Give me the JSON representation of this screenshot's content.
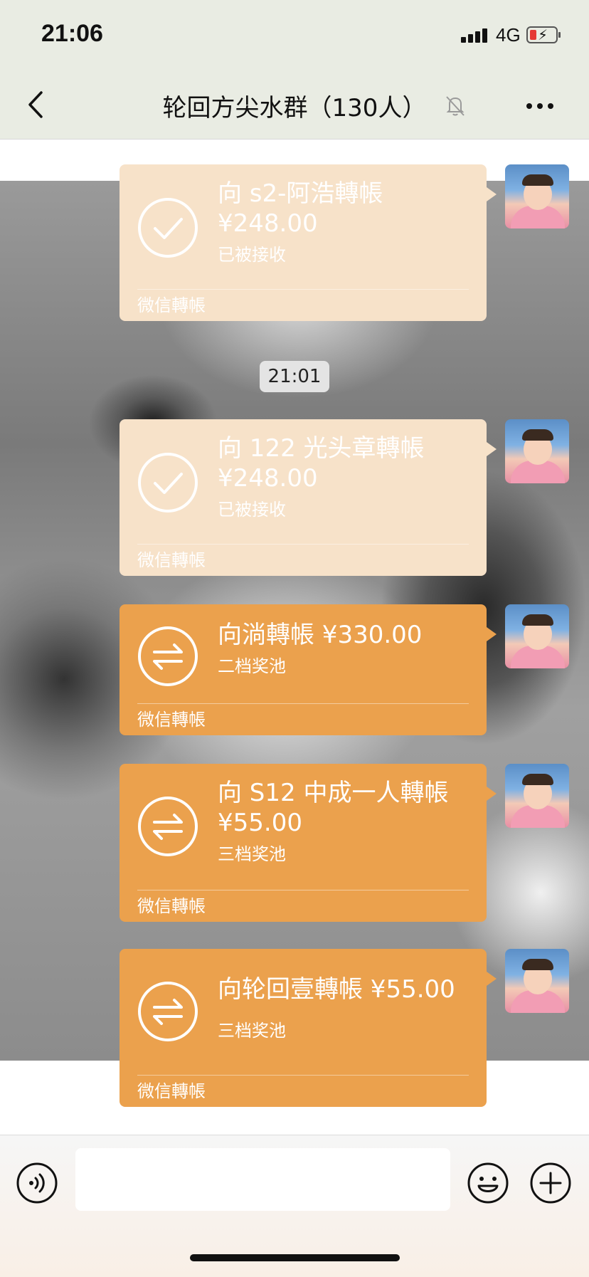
{
  "status_bar": {
    "time": "21:06",
    "network": "4G"
  },
  "nav": {
    "title": "轮回方尖水群（130人）"
  },
  "chat": {
    "messages": [
      {
        "title": "向 s2-阿浩轉帳",
        "amount": "¥248.00",
        "status": "已被接收",
        "footer": "微信轉帳",
        "state": "received"
      },
      {
        "time": "21:01"
      },
      {
        "title": "向 122 光头章轉帳",
        "amount": "¥248.00",
        "status": "已被接收",
        "footer": "微信轉帳",
        "state": "received"
      },
      {
        "title": "向淌轉帳 ¥330.00",
        "status": "二档奖池",
        "footer": "微信轉帳",
        "state": "pending"
      },
      {
        "title": "向 S12 中成一人轉帳",
        "amount": "¥55.00",
        "status": "三档奖池",
        "footer": "微信轉帳",
        "state": "pending"
      },
      {
        "title": "向轮回壹轉帳 ¥55.00",
        "status": "三档奖池",
        "footer": "微信轉帳",
        "state": "pending"
      }
    ]
  },
  "colors": {
    "received_bubble": "#f7e2c9",
    "pending_bubble": "#eba14d",
    "nav_bg": "#e9ece3"
  },
  "icons": [
    "back-icon",
    "mute-bell-icon",
    "more-icon",
    "check-circle-icon",
    "transfer-arrows-icon",
    "voice-icon",
    "emoji-icon",
    "plus-icon"
  ]
}
